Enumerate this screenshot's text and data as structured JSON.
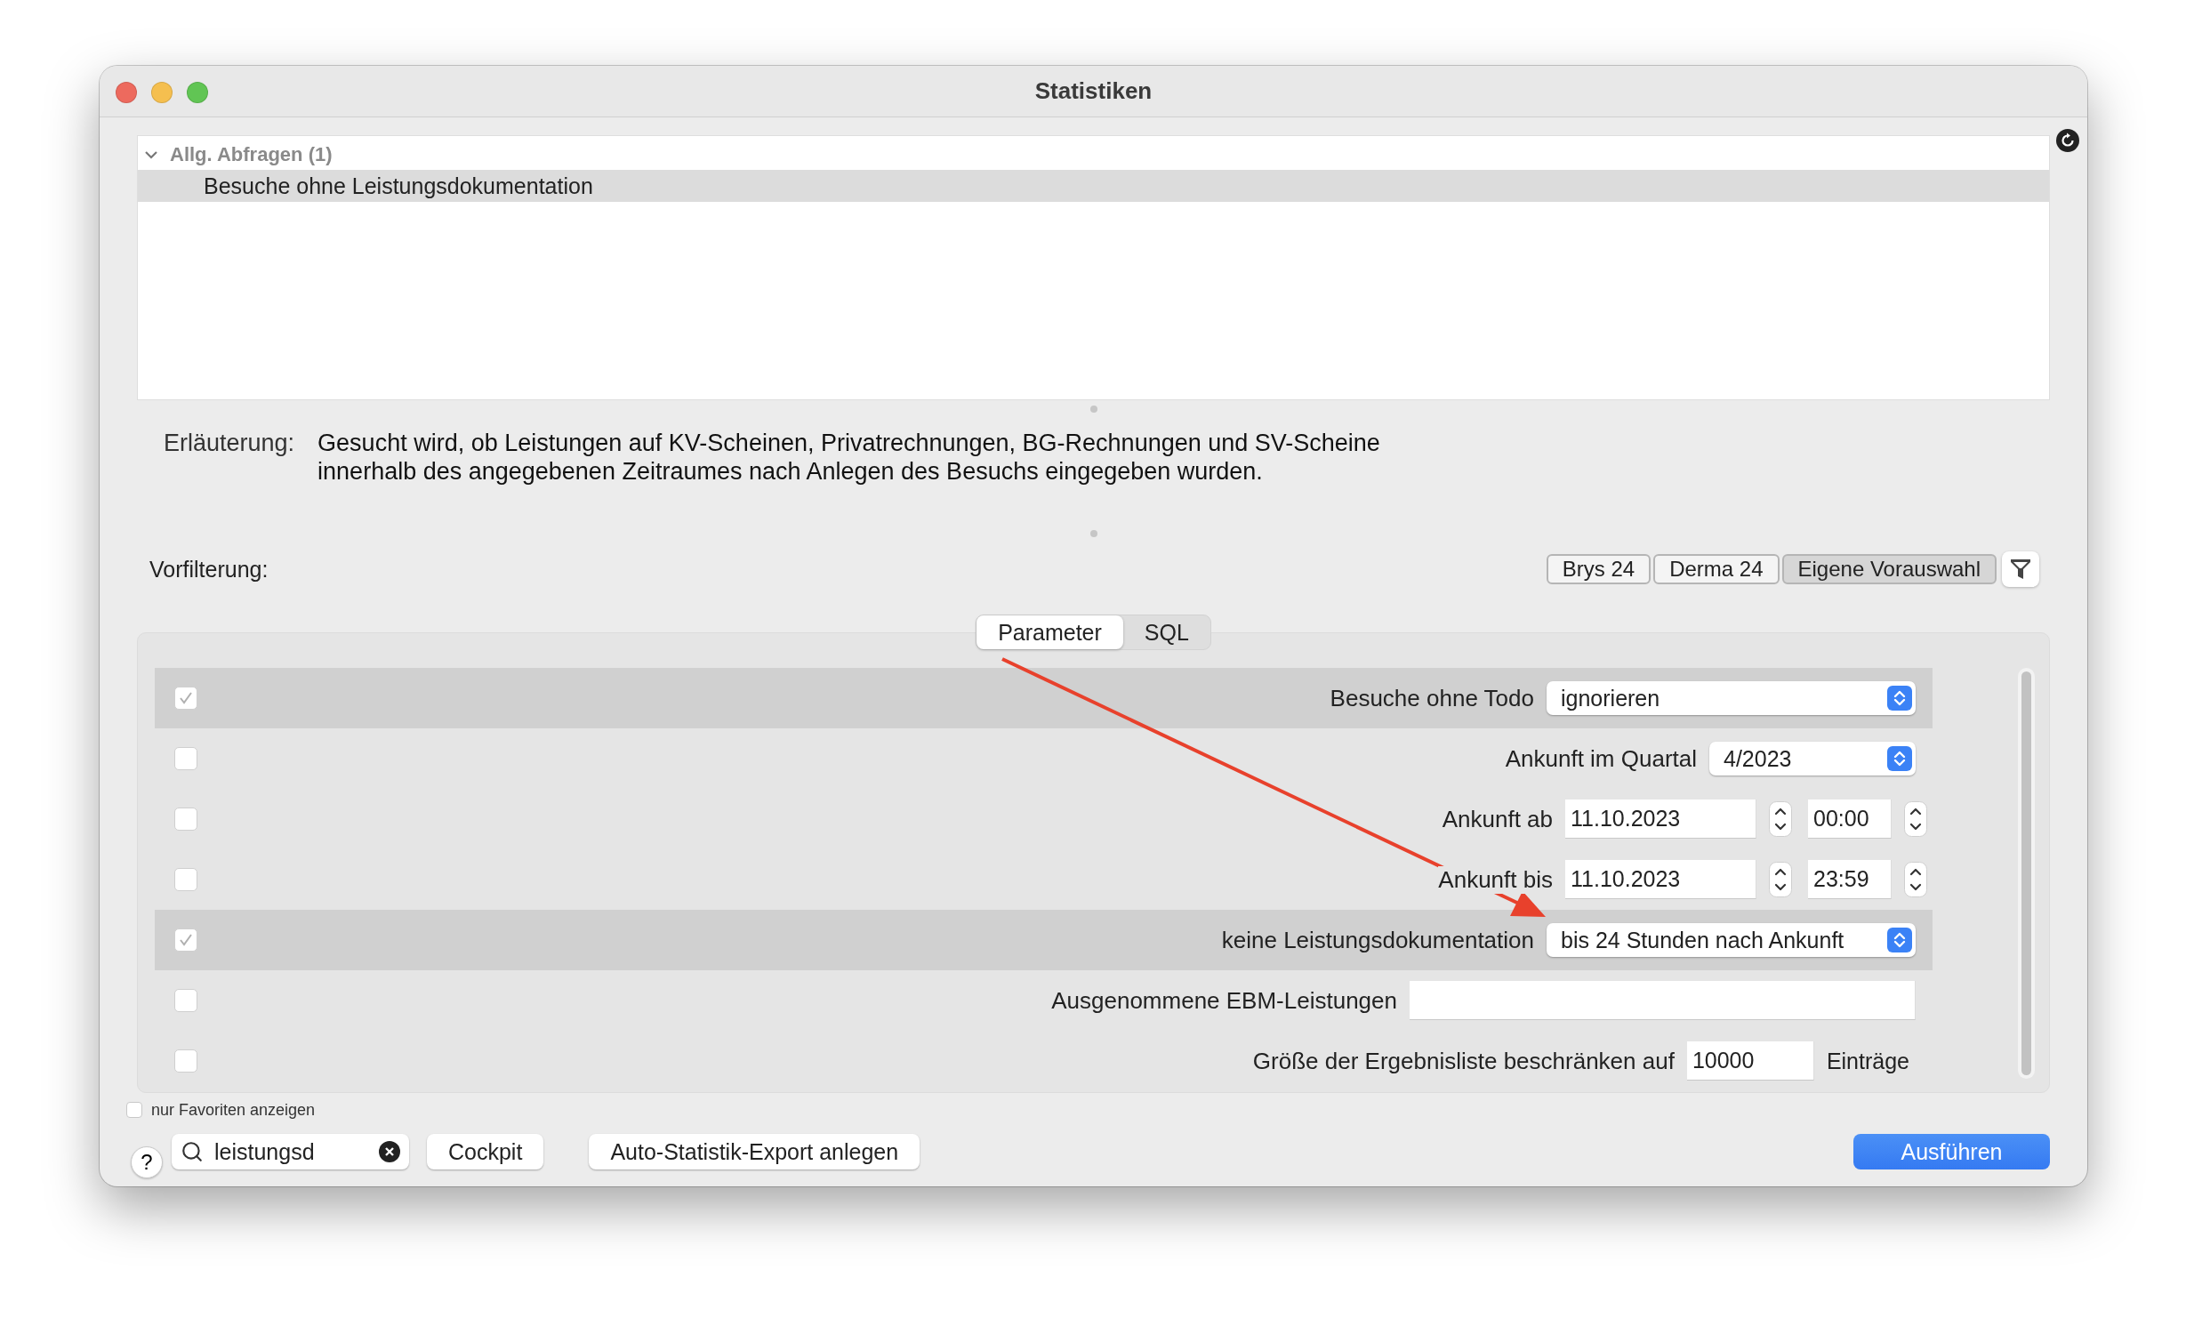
{
  "window": {
    "title": "Statistiken"
  },
  "query_tree": [
    {
      "label": "Allg. Abfragen (1)",
      "expanded": true,
      "children": [
        {
          "label": "Besuche ohne Leistungsdokumentation",
          "selected": true
        }
      ]
    }
  ],
  "explanation": {
    "label": "Erläuterung:",
    "lines": [
      "Gesucht wird, ob Leistungen auf KV-Scheinen, Privatrechnungen, BG-Rechnungen und SV-Scheine",
      "innerhalb des angegebenen Zeitraumes nach Anlegen des Besuchs eingegeben wurden."
    ]
  },
  "prefilter": {
    "label": "Vorfilterung:",
    "buttons": [
      {
        "label": "Brys 24",
        "selected": false
      },
      {
        "label": "Derma 24",
        "selected": false
      },
      {
        "label": "Eigene Vorauswahl",
        "selected": true
      }
    ]
  },
  "tabs": [
    {
      "label": "Parameter",
      "selected": true
    },
    {
      "label": "SQL",
      "selected": false
    }
  ],
  "parameters": [
    {
      "kind": "select",
      "checked": true,
      "label": "Besuche ohne Todo",
      "value": "ignorieren"
    },
    {
      "kind": "select",
      "checked": false,
      "label": "Ankunft im Quartal",
      "value": "4/2023"
    },
    {
      "kind": "datetime",
      "checked": false,
      "label": "Ankunft ab",
      "date": "11.10.2023",
      "time": "00:00"
    },
    {
      "kind": "datetime",
      "checked": false,
      "label": "Ankunft bis",
      "date": "11.10.2023",
      "time": "23:59"
    },
    {
      "kind": "select",
      "checked": true,
      "label": "keine Leistungsdokumentation",
      "value": "bis 24 Stunden nach Ankunft"
    },
    {
      "kind": "text",
      "checked": false,
      "label": "Ausgenommene EBM-Leistungen"
    },
    {
      "kind": "number",
      "checked": false,
      "label": "Größe der Ergebnisliste beschränken auf",
      "value": "10000",
      "suffix": "Einträge"
    }
  ],
  "favorites_only": {
    "label": "nur Favoriten anzeigen",
    "checked": false
  },
  "help": "?",
  "search": {
    "value": "leistungsd"
  },
  "buttons": [
    {
      "label": "Cockpit",
      "kind": "secondary"
    },
    {
      "label": "Auto-Statistik-Export anlegen",
      "kind": "secondary"
    },
    {
      "label": "Ausführen",
      "kind": "primary"
    }
  ]
}
